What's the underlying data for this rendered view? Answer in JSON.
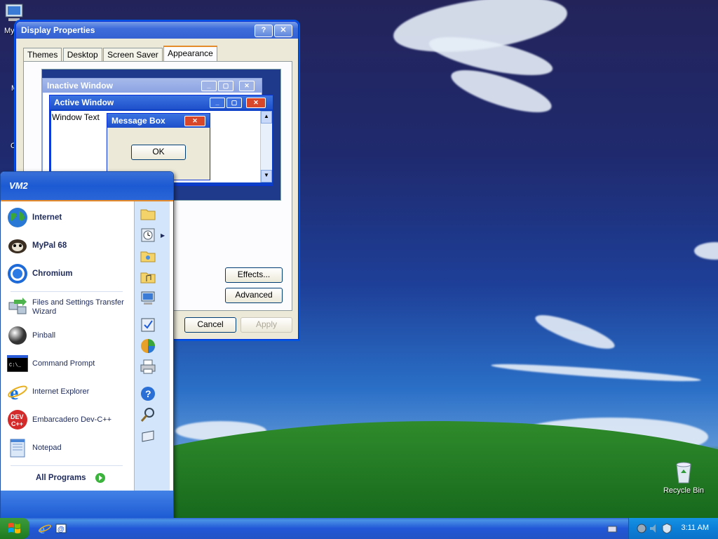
{
  "desktop": {
    "icons": [
      {
        "label": "My",
        "icon": "computer-icon"
      },
      {
        "label": "M",
        "icon": "documents-icon"
      },
      {
        "label": "C",
        "icon": "control-icon"
      }
    ],
    "recycle_bin": "Recycle Bin"
  },
  "dialog": {
    "title": "Display Properties",
    "help_btn": "?",
    "close_btn": "✕",
    "tabs": [
      "Themes",
      "Desktop",
      "Screen Saver",
      "Appearance"
    ],
    "active_tab": "Appearance",
    "preview": {
      "inactive_title": "Inactive Window",
      "active_title": "Active Window",
      "window_text": "Window Text",
      "msgbox_title": "Message Box",
      "ok_label": "OK"
    },
    "effects_btn": "Effects...",
    "advanced_btn": "Advanced",
    "cancel_btn": "Cancel",
    "apply_btn": "Apply"
  },
  "start_menu": {
    "user": "VM2",
    "pinned": [
      {
        "label": "Internet",
        "icon": "globe-icon"
      },
      {
        "label": "MyPal 68",
        "icon": "raccoon-icon"
      },
      {
        "label": "Chromium",
        "icon": "chromium-icon"
      }
    ],
    "recent": [
      {
        "label": "Files and Settings Transfer Wizard",
        "icon": "transfer-wizard-icon"
      },
      {
        "label": "Pinball",
        "icon": "pinball-icon"
      },
      {
        "label": "Command Prompt",
        "icon": "cmd-icon"
      },
      {
        "label": "Internet Explorer",
        "icon": "ie-icon"
      },
      {
        "label": "Embarcadero Dev-C++",
        "icon": "devcpp-icon"
      },
      {
        "label": "Notepad",
        "icon": "notepad-icon"
      }
    ],
    "all_programs": "All Programs",
    "right_icons": [
      "documents-folder-icon",
      "recent-icon",
      "pictures-folder-icon",
      "music-folder-icon",
      "computer-icon",
      "control-panel-icon",
      "programs-access-icon",
      "printers-icon",
      "help-icon",
      "search-icon",
      "run-icon"
    ]
  },
  "taskbar": {
    "quicklaunch": [
      "ie-icon",
      "outlook-icon"
    ],
    "tray_icons": [
      "network-icon",
      "safely-remove-icon",
      "volume-icon",
      "security-icon"
    ],
    "clock": "3:11 AM"
  },
  "colors": {
    "xp_blue": "#245edb",
    "dialog_bg": "#ece9d8",
    "start_orange": "#e68b2c"
  }
}
